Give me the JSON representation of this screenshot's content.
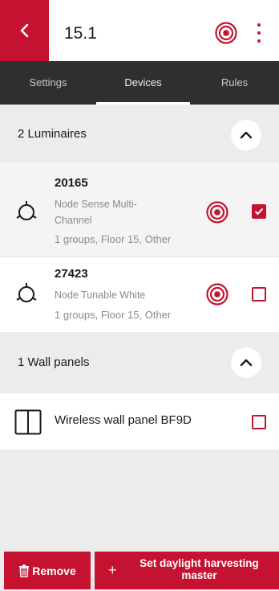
{
  "header": {
    "back_icon": "chevron-left-icon",
    "title": "15.1",
    "identify_icon": "identify-target-icon",
    "menu_icon": "more-vertical-icon"
  },
  "tabs": [
    {
      "label": "Settings",
      "active": false
    },
    {
      "label": "Devices",
      "active": true
    },
    {
      "label": "Rules",
      "active": false
    }
  ],
  "luminaires": {
    "title": "2 Luminaires",
    "expanded": true,
    "items": [
      {
        "name": "20165",
        "type": "Node Sense Multi-Channel",
        "meta": "1 groups, Floor 15, Other",
        "checked": true
      },
      {
        "name": "27423",
        "type": "Node Tunable White",
        "meta": "1 groups, Floor 15, Other",
        "checked": false
      }
    ]
  },
  "wall_panels": {
    "title": "1 Wall panels",
    "expanded": true,
    "items": [
      {
        "name": "Wireless wall panel BF9D",
        "checked": false
      }
    ]
  },
  "actions": {
    "remove_label": "Remove",
    "remove_icon": "trash-icon",
    "daylight_plus": "+",
    "daylight_label": "Set daylight harvesting master"
  },
  "colors": {
    "accent": "#c41230",
    "tab_bar": "#2f2f2f",
    "section_bg": "#ececec"
  }
}
